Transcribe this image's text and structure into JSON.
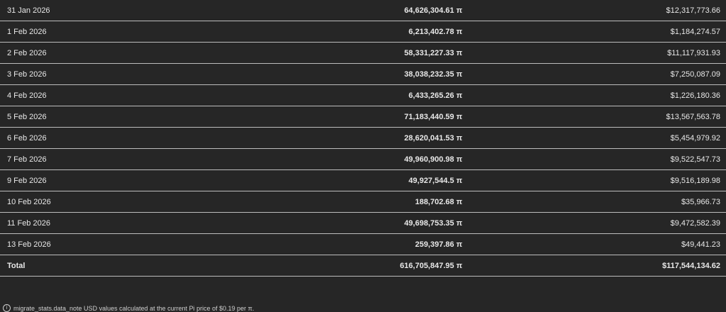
{
  "rows": [
    {
      "date": "31 Jan 2026",
      "pi": "64,626,304.61 π",
      "usd": "$12,317,773.66"
    },
    {
      "date": "1 Feb 2026",
      "pi": "6,213,402.78 π",
      "usd": "$1,184,274.57"
    },
    {
      "date": "2 Feb 2026",
      "pi": "58,331,227.33 π",
      "usd": "$11,117,931.93"
    },
    {
      "date": "3 Feb 2026",
      "pi": "38,038,232.35 π",
      "usd": "$7,250,087.09"
    },
    {
      "date": "4 Feb 2026",
      "pi": "6,433,265.26 π",
      "usd": "$1,226,180.36"
    },
    {
      "date": "5 Feb 2026",
      "pi": "71,183,440.59 π",
      "usd": "$13,567,563.78"
    },
    {
      "date": "6 Feb 2026",
      "pi": "28,620,041.53 π",
      "usd": "$5,454,979.92"
    },
    {
      "date": "7 Feb 2026",
      "pi": "49,960,900.98 π",
      "usd": "$9,522,547.73"
    },
    {
      "date": "9 Feb 2026",
      "pi": "49,927,544.5 π",
      "usd": "$9,516,189.98"
    },
    {
      "date": "10 Feb 2026",
      "pi": "188,702.68 π",
      "usd": "$35,966.73"
    },
    {
      "date": "11 Feb 2026",
      "pi": "49,698,753.35 π",
      "usd": "$9,472,582.39"
    },
    {
      "date": "13 Feb 2026",
      "pi": "259,397.86 π",
      "usd": "$49,441.23"
    }
  ],
  "total": {
    "label": "Total",
    "pi": "616,705,847.95 π",
    "usd": "$117,544,134.62"
  },
  "footer": {
    "icon": "info-icon",
    "note": "migrate_stats.data_note USD values calculated at the current Pi price of $0.19 per π."
  }
}
